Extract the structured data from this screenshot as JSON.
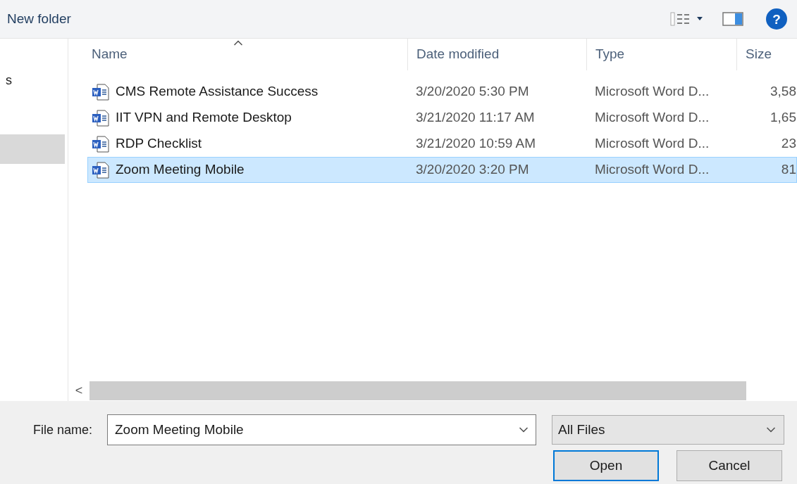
{
  "toolbar": {
    "new_folder": "New folder",
    "help": "?"
  },
  "sidebar": {
    "items": [
      {
        "label": "s",
        "selected": false
      },
      {
        "selected": true
      }
    ]
  },
  "table": {
    "columns": [
      {
        "label": "Name",
        "sorted": true
      },
      {
        "label": "Date modified",
        "sorted": false
      },
      {
        "label": "Type",
        "sorted": false
      },
      {
        "label": "Size",
        "sorted": false
      }
    ],
    "rows": [
      {
        "name": "CMS Remote Assistance Success",
        "date": "3/20/2020 5:30 PM",
        "type": "Microsoft Word D...",
        "size": "3,58",
        "selected": false
      },
      {
        "name": "IIT VPN and Remote Desktop",
        "date": "3/21/2020 11:17 AM",
        "type": "Microsoft Word D...",
        "size": "1,65",
        "selected": false
      },
      {
        "name": "RDP Checklist",
        "date": "3/21/2020 10:59 AM",
        "type": "Microsoft Word D...",
        "size": "23",
        "selected": false
      },
      {
        "name": "Zoom Meeting Mobile",
        "date": "3/20/2020 3:20 PM",
        "type": "Microsoft Word D...",
        "size": "81",
        "selected": true
      }
    ]
  },
  "scrollbar_left": "<",
  "file_name": {
    "label": "File name:",
    "value": "Zoom Meeting Mobile"
  },
  "filter": {
    "value": "All Files"
  },
  "buttons": [
    {
      "label": "Open",
      "default": true
    },
    {
      "label": "Cancel",
      "default": false
    }
  ]
}
